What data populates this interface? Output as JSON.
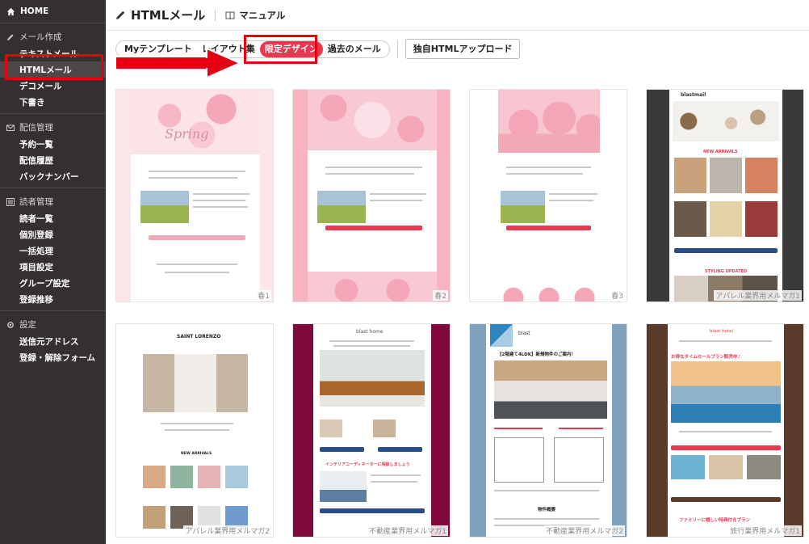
{
  "sidebar": {
    "home": "HOME",
    "sections": [
      {
        "title": "メール作成",
        "items": [
          "テキストメール",
          "HTMLメール",
          "デコメール",
          "下書き"
        ]
      },
      {
        "title": "配信管理",
        "items": [
          "予約一覧",
          "配信履歴",
          "バックナンバー"
        ]
      },
      {
        "title": "読者管理",
        "items": [
          "読者一覧",
          "個別登録",
          "一括処理",
          "項目設定",
          "グループ設定",
          "登録推移"
        ]
      },
      {
        "title": "設定",
        "items": [
          "送信元アドレス",
          "登録・解除フォーム"
        ]
      }
    ]
  },
  "header": {
    "title": "HTMLメール",
    "manual": "マニュアル"
  },
  "tabs": {
    "items": [
      "Myテンプレート",
      "レイアウト集",
      "限定デザイン",
      "過去のメール"
    ],
    "active": "限定デザイン",
    "upload": "独自HTMLアップロード"
  },
  "templates": [
    {
      "label": "春1"
    },
    {
      "label": "春2"
    },
    {
      "label": "春3"
    },
    {
      "label": "アパレル業界用メルマガ1"
    },
    {
      "label": "アパレル業界用メルマガ2"
    },
    {
      "label": "不動産業界用メルマガ1"
    },
    {
      "label": "不動産業界用メルマガ2"
    },
    {
      "label": "旅行業界用メルマガ1"
    }
  ],
  "template_text": {
    "spring": "Spring",
    "brand": "blastmail",
    "new_arrivals": "NEW ARRIVALS",
    "styling": "STYLING UPDATED",
    "saint": "SAINT LORENZO",
    "blast_home": "blast home",
    "interior": "インテリアコーディネーターに相談しましょう",
    "blast": "blast",
    "property": "【2階建て4LDK】新規物件のご案内！",
    "overview": "物件概要",
    "hotel": "blast hotel",
    "sale": "お得なタイムセールプラン販売中♪",
    "family": "ファミリーに嬉しい特典付きプラン"
  },
  "colors": {
    "sidebar_bg": "#33302f",
    "accent": "#e8384f",
    "highlight": "#e60012"
  }
}
